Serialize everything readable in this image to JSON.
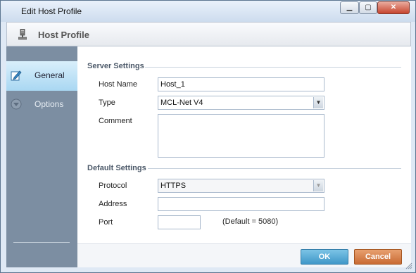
{
  "window": {
    "title": "Edit Host Profile"
  },
  "header": {
    "title": "Host Profile",
    "icon": "computer-icon"
  },
  "sidebar": {
    "items": [
      {
        "label": "General",
        "icon": "edit-icon",
        "active": true
      },
      {
        "label": "Options",
        "icon": "options-icon",
        "active": false
      }
    ]
  },
  "server_settings": {
    "title": "Server Settings",
    "host_name": {
      "label": "Host Name",
      "value": "Host_1"
    },
    "type": {
      "label": "Type",
      "value": "MCL-Net V4"
    },
    "comment": {
      "label": "Comment",
      "value": ""
    }
  },
  "default_settings": {
    "title": "Default Settings",
    "protocol": {
      "label": "Protocol",
      "value": "HTTPS"
    },
    "address": {
      "label": "Address",
      "value": ""
    },
    "port": {
      "label": "Port",
      "value": "",
      "hint": "(Default = 5080)"
    }
  },
  "buttons": {
    "ok": "OK",
    "cancel": "Cancel"
  },
  "colors": {
    "ok_button": "#4ea3d2",
    "cancel_button": "#d07a41",
    "sidebar": "#7c8ea2",
    "accent": "#a9d7f2"
  }
}
